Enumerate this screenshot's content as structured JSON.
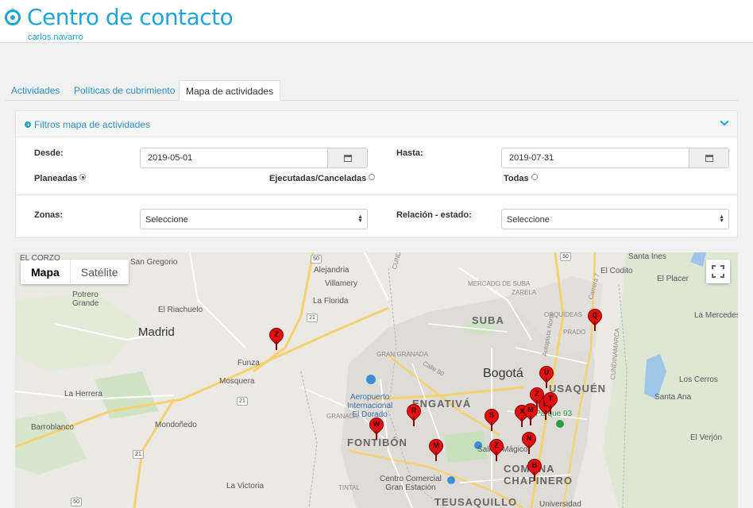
{
  "app": {
    "title": "Centro de contacto",
    "user": "carlos.navarro"
  },
  "tabs": [
    {
      "label": "Actividades"
    },
    {
      "label": "Políticas de cubrimiento"
    },
    {
      "label": "Mapa de actividades"
    }
  ],
  "filters": {
    "title": "Filtros mapa de actividades",
    "desde_label": "Desde:",
    "desde_value": "2019-05-01",
    "hasta_label": "Hasta:",
    "hasta_value": "2019-07-31",
    "radio_planeadas": "Planeadas",
    "radio_ejecutadas": "Ejecutadas/Canceladas",
    "radio_todas": "Todas",
    "zonas_label": "Zonas:",
    "zonas_value": "Seleccione",
    "relacion_label": "Relación - estado:",
    "relacion_value": "Seleccione"
  },
  "map": {
    "type_map": "Mapa",
    "type_satellite": "Satélite",
    "places": {
      "el_corzo": "EL CORZO",
      "san_gregorio": "San Gregorio",
      "alejandria": "Alejandria",
      "villamery": "Villamery",
      "potrero_grande": "Potrero\nGrande",
      "el_riachuelo": "El Riachuelo",
      "la_florida": "La Florida",
      "madrid": "Madrid",
      "funza": "Funza",
      "mosquera": "Mosquera",
      "la_herrera": "La Herrera",
      "barroblanco": "Barroblanco",
      "mondonedo": "Mondoñedo",
      "la_victoria": "La Victoria",
      "aeropuerto": "Aeropuerto\nInternacional\nEl Dorado",
      "engativa": "ENGATIVÁ",
      "fontibon": "FONTIBÓN",
      "suba": "SUBA",
      "bogota": "Bogotá",
      "usaquen": "USAQUÉN",
      "parque_93": "Parque 93",
      "salitre": "Salitre Mágico",
      "comuna_chapinero": "COMUNA\nCHAPINERO",
      "teusaquillo": "TEUSAQUILLO",
      "cc_gran_estacion": "Centro Comercial\nGran Estación",
      "santa_ines": "Santa Ines",
      "el_codito": "El Codito",
      "el_placer": "El Placer",
      "la_mercedes": "La Mercedes",
      "los_cerros": "Los Cerros",
      "santa_ana": "Santa Ana",
      "el_verjon": "El Verjón",
      "universidad": "Universidad",
      "tintal": "TINTAL",
      "orquideas": "ORQUÍDEAS",
      "prado": "PRADO",
      "cundinamarca_1": "CUNDINAMARCA",
      "cundinamarca_2": "CUNDINAMARCA",
      "gran_granada": "GRAN GRANADA",
      "granada": "GRANADA",
      "calle_80": "Calle 80",
      "autopista": "Autopista Norte",
      "carrera_7": "Carrera 7",
      "mercado_suba": "MERCADO DE SUBA",
      "zarela": "ZARELA"
    },
    "shields": [
      "50",
      "50",
      "21",
      "21",
      "21",
      "50"
    ],
    "markers": [
      "Z",
      "W",
      "R",
      "S",
      "U",
      "Z",
      "X",
      "M",
      "D",
      "T",
      "N",
      "Z",
      "Q",
      "B",
      "M"
    ]
  }
}
